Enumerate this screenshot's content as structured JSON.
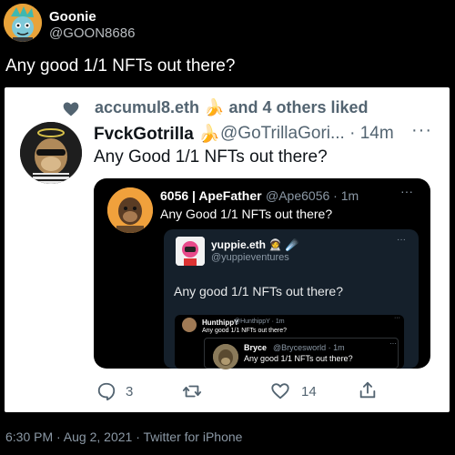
{
  "outer_tweet": {
    "display_name": "Goonie",
    "handle": "@GOON8686",
    "text": "Any good 1/1 NFTs out there?",
    "meta": "6:30 PM · Aug 2, 2021 · Twitter for iPhone"
  },
  "screenshot": {
    "liked_by": "accumul8.eth 🍌 and 4 others liked",
    "display_name": "FvckGotrilla 🍌",
    "handle_time": "@GoTrillaGori... · 14m",
    "more": "···",
    "text": "Any Good 1/1 NFTs out there?",
    "actions": {
      "reply_count": "3",
      "like_count": "14"
    },
    "inner": {
      "display_name": "6056 | ApeFather",
      "handle_time": "@Ape6056 · 1m",
      "more": "···",
      "text": "Any Good 1/1 NFTs out there?",
      "quote": {
        "display_name": "yuppie.eth 🧑‍🚀 ☄️",
        "handle": "@yuppieventures",
        "more": "···",
        "text": "Any good 1/1 NFTs out there?",
        "quote": {
          "display_name": "HunthippY",
          "handle_time": "@HunthippY · 1m",
          "more": "···",
          "text": "Any good 1/1 NFTs out there?",
          "quote": {
            "display_name": "Bryce",
            "handle_time": "@Brycesworld · 1m",
            "more": "···",
            "text": "Any good 1/1 NFTs out there?"
          }
        }
      }
    }
  },
  "colors": {
    "background": "#000000",
    "card": "#ffffff",
    "accent_blue": "#1d9bf0",
    "muted": "#536471"
  }
}
